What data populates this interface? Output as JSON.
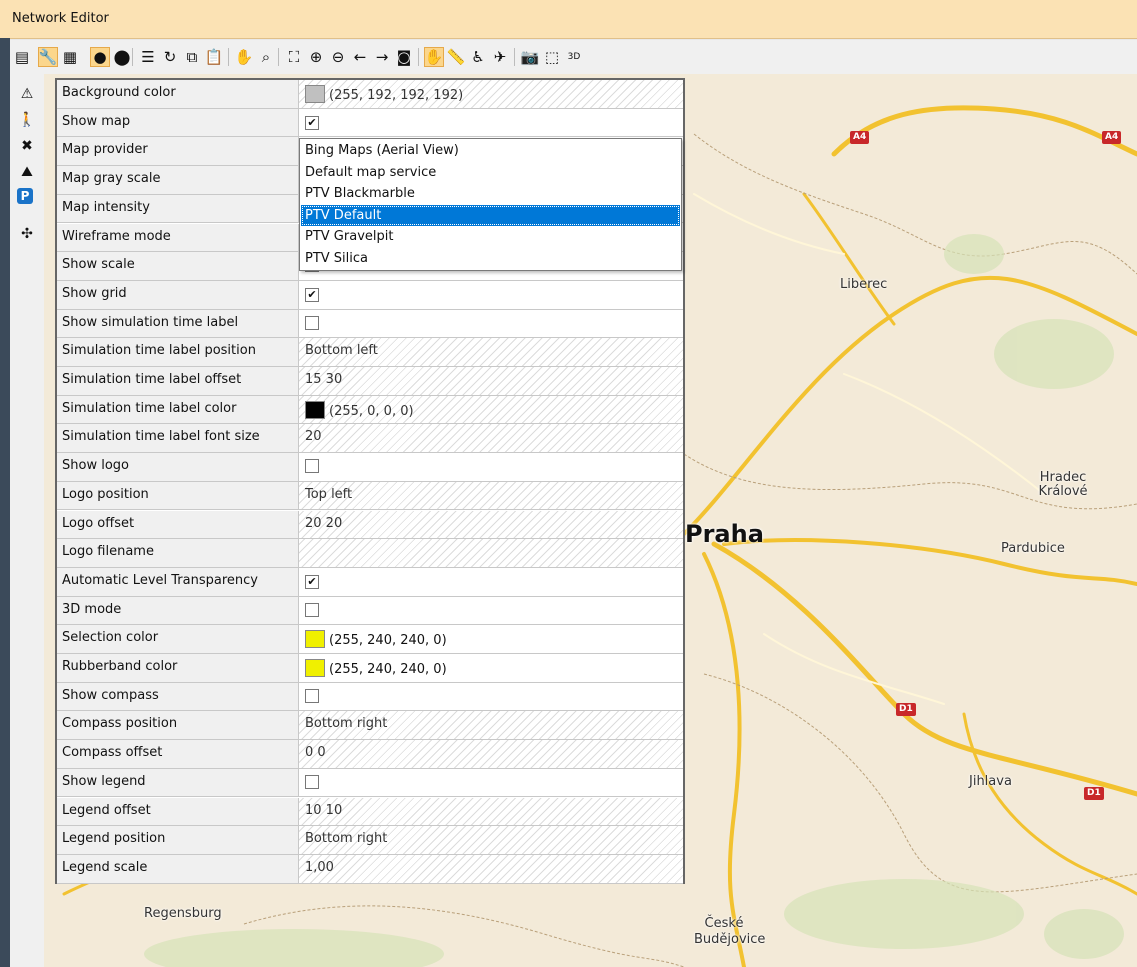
{
  "window": {
    "title": "Network Editor"
  },
  "toolbar": {
    "icons": [
      {
        "name": "layout-menu-icon",
        "glyph": "▤"
      },
      {
        "name": "wrench-icon",
        "glyph": "🔧",
        "active": true
      },
      {
        "name": "grid-icon",
        "glyph": "▦"
      },
      {
        "name": "globe-icon",
        "glyph": "●",
        "active": true
      },
      {
        "name": "location-pin-icon",
        "glyph": "⬤"
      },
      {
        "name": "list-icon",
        "glyph": "☰"
      },
      {
        "name": "redo-icon",
        "glyph": "↻"
      },
      {
        "name": "copy-icon",
        "glyph": "⧉"
      },
      {
        "name": "clipboard-icon",
        "glyph": "📋"
      },
      {
        "name": "hand-drag-icon",
        "glyph": "✋"
      },
      {
        "name": "zoom-select-icon",
        "glyph": "⌕"
      },
      {
        "name": "zoom-fit-icon",
        "glyph": "⛶"
      },
      {
        "name": "zoom-in-icon",
        "glyph": "⊕"
      },
      {
        "name": "zoom-out-icon",
        "glyph": "⊖"
      },
      {
        "name": "back-arrow-icon",
        "glyph": "←"
      },
      {
        "name": "forward-arrow-icon",
        "glyph": "→"
      },
      {
        "name": "camera-position-icon",
        "glyph": "◙"
      },
      {
        "name": "pan-hand-icon",
        "glyph": "✋",
        "active": true
      },
      {
        "name": "measure-icon",
        "glyph": "📏"
      },
      {
        "name": "pedestrian-icon",
        "glyph": "♿"
      },
      {
        "name": "flight-icon",
        "glyph": "✈"
      },
      {
        "name": "screenshot-icon",
        "glyph": "📷"
      },
      {
        "name": "cube-edit-icon",
        "glyph": "⬚"
      },
      {
        "name": "3d-mode-icon",
        "glyph": "3D"
      }
    ]
  },
  "sidebar": {
    "icons": [
      {
        "name": "vehicle-warning-icon",
        "glyph": "⚠"
      },
      {
        "name": "pedestrian-icon",
        "glyph": "🚶"
      },
      {
        "name": "conflict-icon",
        "glyph": "✖"
      },
      {
        "name": "area-icon",
        "glyph": "⛰"
      },
      {
        "name": "parking-icon",
        "glyph": "P"
      },
      {
        "name": "network-icon",
        "glyph": "✣"
      }
    ]
  },
  "properties": [
    {
      "name": "Background color",
      "type": "color",
      "swatch": "#c0c0c0",
      "value": "(255, 192, 192, 192)",
      "ro": true
    },
    {
      "name": "Show map",
      "type": "checkbox",
      "checked": true
    },
    {
      "name": "Map provider",
      "type": "text",
      "value": "PTV Default"
    },
    {
      "name": "Map gray scale",
      "type": "text",
      "value": ""
    },
    {
      "name": "Map intensity",
      "type": "text",
      "value": ""
    },
    {
      "name": "Wireframe mode",
      "type": "text",
      "value": ""
    },
    {
      "name": "Show scale",
      "type": "checkbox",
      "checked": false
    },
    {
      "name": "Show grid",
      "type": "checkbox",
      "checked": true
    },
    {
      "name": "Show simulation time label",
      "type": "checkbox",
      "checked": false
    },
    {
      "name": "Simulation time label position",
      "type": "text",
      "value": "Bottom left",
      "ro": true
    },
    {
      "name": "Simulation time label offset",
      "type": "text",
      "value": "15 30",
      "ro": true
    },
    {
      "name": "Simulation time label color",
      "type": "color",
      "swatch": "#000000",
      "value": "(255, 0, 0, 0)",
      "ro": true
    },
    {
      "name": "Simulation time label font size",
      "type": "text",
      "value": "20",
      "ro": true
    },
    {
      "name": "Show logo",
      "type": "checkbox",
      "checked": false
    },
    {
      "name": "Logo position",
      "type": "text",
      "value": "Top left",
      "ro": true
    },
    {
      "name": "Logo offset",
      "type": "text",
      "value": "20 20",
      "ro": true
    },
    {
      "name": "Logo filename",
      "type": "text",
      "value": "",
      "ro": true
    },
    {
      "name": "Automatic Level Transparency",
      "type": "checkbox",
      "checked": true
    },
    {
      "name": "3D mode",
      "type": "checkbox",
      "checked": false
    },
    {
      "name": "Selection color",
      "type": "color",
      "swatch": "#f0f000",
      "value": "(255, 240, 240, 0)",
      "ro": false
    },
    {
      "name": "Rubberband color",
      "type": "color",
      "swatch": "#f0f000",
      "value": "(255, 240, 240, 0)",
      "ro": false
    },
    {
      "name": "Show compass",
      "type": "checkbox",
      "checked": false
    },
    {
      "name": "Compass position",
      "type": "text",
      "value": "Bottom right",
      "ro": true
    },
    {
      "name": "Compass offset",
      "type": "text",
      "value": "0 0",
      "ro": true
    },
    {
      "name": "Show legend",
      "type": "checkbox",
      "checked": false
    },
    {
      "name": "Legend offset",
      "type": "text",
      "value": "10 10",
      "ro": true
    },
    {
      "name": "Legend position",
      "type": "text",
      "value": "Bottom right",
      "ro": true
    },
    {
      "name": "Legend scale",
      "type": "text",
      "value": "1,00",
      "ro": true
    }
  ],
  "map_provider_dropdown": {
    "options": [
      "Bing Maps (Aerial View)",
      "Default map service",
      "PTV Blackmarble",
      "PTV Default",
      "PTV Gravelpit",
      "PTV Silica"
    ],
    "selected": "PTV Default"
  },
  "map": {
    "cities": [
      "Liberec",
      "Hradec Králové",
      "Praha",
      "Pardubice",
      "Jihlava",
      "Regensburg",
      "České Budějovice"
    ],
    "road_badges": [
      "A4",
      "A4",
      "D1",
      "D1"
    ]
  },
  "colors": {
    "selection": "#0078d7",
    "titlebar": "#fbe2b4"
  }
}
